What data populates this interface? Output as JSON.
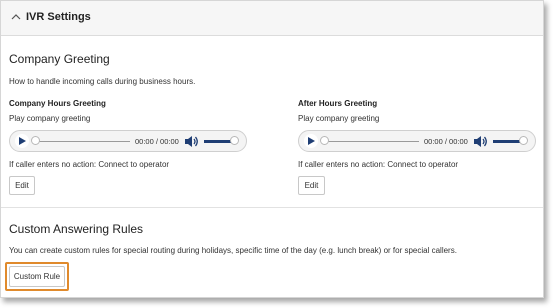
{
  "header": {
    "title": "IVR Settings",
    "toggle_icon": "chevron-up-icon"
  },
  "greeting": {
    "title": "Company Greeting",
    "description": "How to handle incoming calls during business hours.",
    "company_hours": {
      "title": "Company Hours Greeting",
      "play_label": "Play company greeting",
      "time": "00:00 / 00:00",
      "no_action": "If caller enters no action: Connect to operator",
      "edit_label": "Edit"
    },
    "after_hours": {
      "title": "After Hours Greeting",
      "play_label": "Play company greeting",
      "time": "00:00 / 00:00",
      "no_action": "If caller enters no action: Connect to operator",
      "edit_label": "Edit"
    }
  },
  "rules": {
    "title": "Custom Answering Rules",
    "description": "You can create custom rules for special routing during holidays, specific time of the day (e.g. lunch break) or for special callers.",
    "button_label": "Custom Rule"
  },
  "colors": {
    "highlight": "#e08a2c",
    "player_accent": "#1f3e74"
  }
}
